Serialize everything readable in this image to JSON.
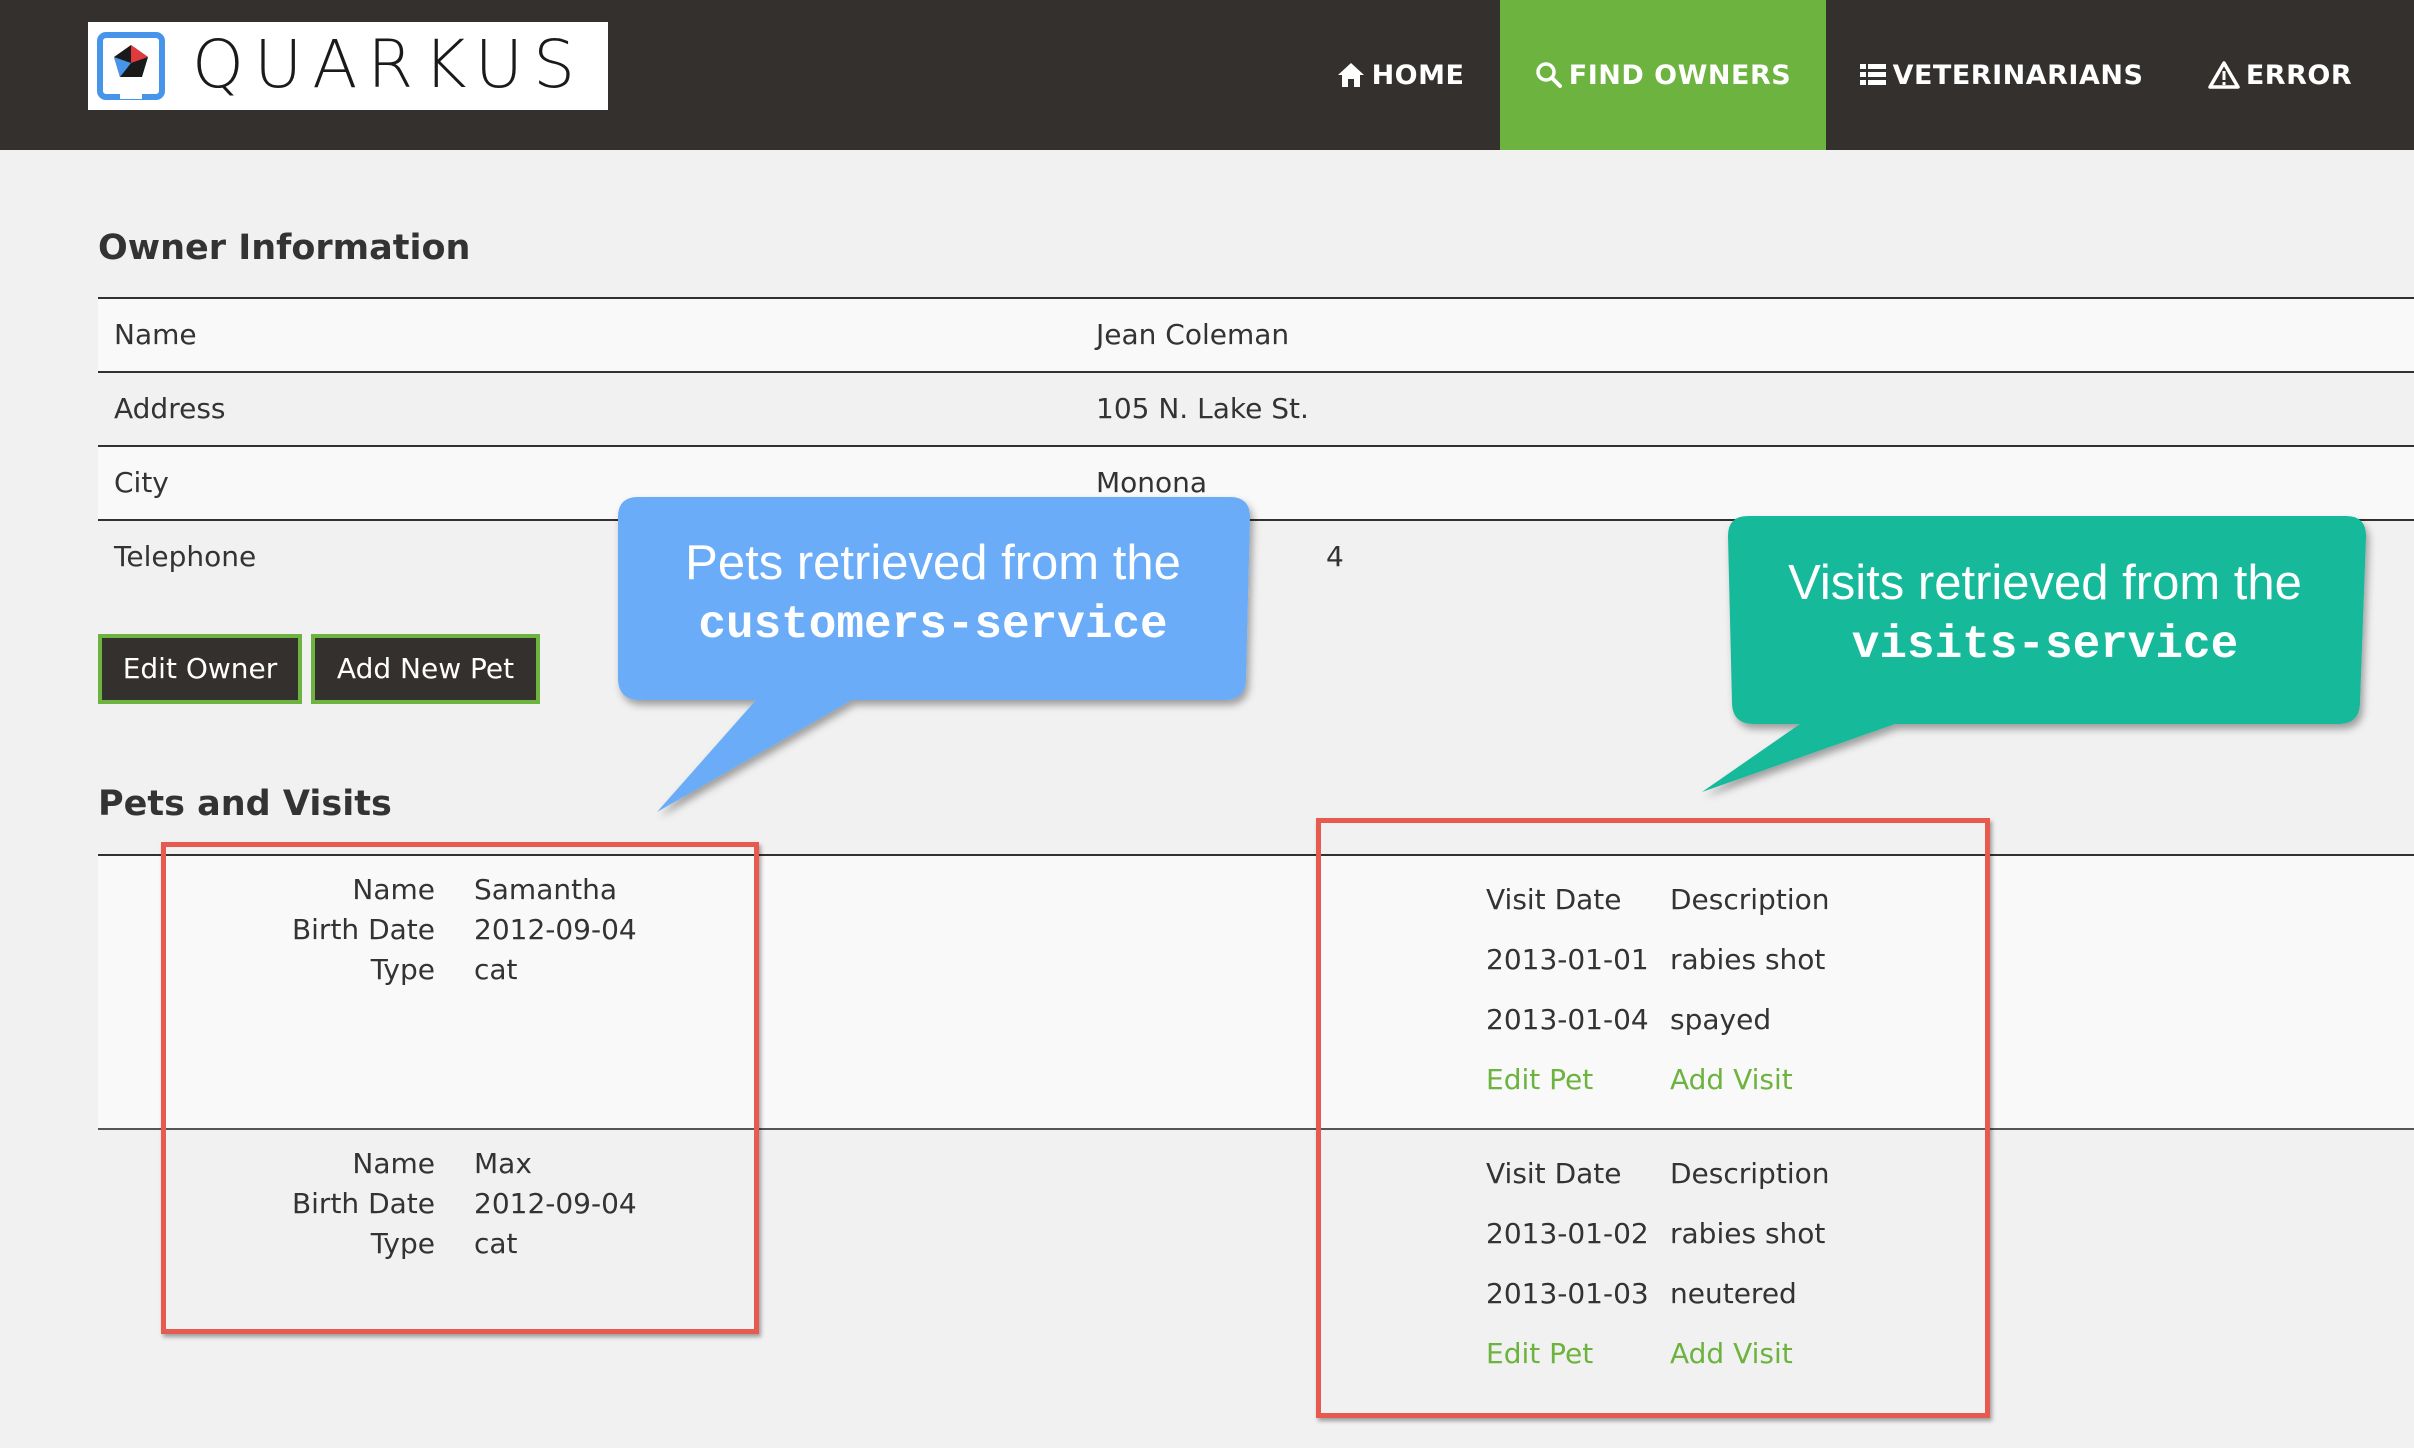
{
  "navbar": {
    "logo_text": "QUARKUS",
    "items": [
      {
        "label": "HOME",
        "icon": "home-icon",
        "active": false
      },
      {
        "label": "FIND OWNERS",
        "icon": "search-icon",
        "active": true
      },
      {
        "label": "VETERINARIANS",
        "icon": "list-icon",
        "active": false
      },
      {
        "label": "ERROR",
        "icon": "warning-icon",
        "active": false
      }
    ],
    "colors": {
      "background": "#34302d",
      "active": "#6db33f"
    }
  },
  "owner": {
    "heading": "Owner Information",
    "rows": [
      {
        "label": "Name",
        "value": "Jean Coleman"
      },
      {
        "label": "Address",
        "value": "105 N. Lake St."
      },
      {
        "label": "City",
        "value": "Monona"
      },
      {
        "label": "Telephone",
        "value": "4"
      }
    ],
    "buttons": {
      "edit": "Edit Owner",
      "add_pet": "Add New Pet"
    }
  },
  "pets": {
    "heading": "Pets and Visits",
    "field_labels": {
      "name": "Name",
      "birth_date": "Birth Date",
      "type": "Type"
    },
    "visit_headers": {
      "date": "Visit Date",
      "description": "Description"
    },
    "links": {
      "edit_pet": "Edit Pet",
      "add_visit": "Add Visit"
    },
    "items": [
      {
        "name": "Samantha",
        "birth_date": "2012-09-04",
        "type": "cat",
        "visits": [
          {
            "date": "2013-01-01",
            "description": "rabies shot"
          },
          {
            "date": "2013-01-04",
            "description": "spayed"
          }
        ]
      },
      {
        "name": "Max",
        "birth_date": "2012-09-04",
        "type": "cat",
        "visits": [
          {
            "date": "2013-01-02",
            "description": "rabies shot"
          },
          {
            "date": "2013-01-03",
            "description": "neutered"
          }
        ]
      }
    ]
  },
  "callouts": {
    "customers": {
      "line1": "Pets retrieved from the",
      "line2": "customers-service",
      "color": "#6aacf8"
    },
    "visits": {
      "line1": "Visits retrieved from the",
      "line2": "visits-service",
      "color": "#13b99a"
    },
    "box_color": "#e65a4f"
  },
  "accent": "#6db33f"
}
